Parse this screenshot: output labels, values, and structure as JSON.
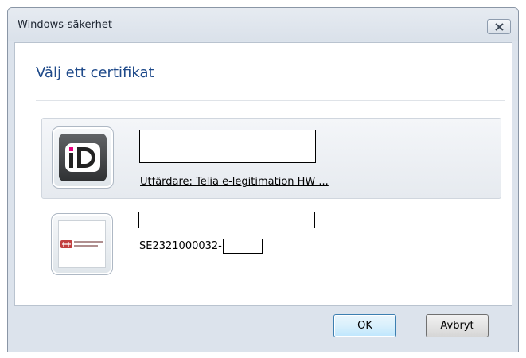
{
  "window": {
    "title": "Windows-säkerhet"
  },
  "dialog": {
    "heading": "Välj ett certifikat"
  },
  "certificates": [
    {
      "icon": "bankid-icon",
      "subject": "",
      "detail": "Utfärdare: Telia e-legitimation HW ...",
      "selected": true
    },
    {
      "icon": "county-seal-icon",
      "subject": "",
      "detail": "SE2321000032-",
      "selected": false
    }
  ],
  "buttons": {
    "ok": "OK",
    "cancel": "Avbryt"
  },
  "colors": {
    "heading": "#1f4a8a",
    "frame": "#dce3ec",
    "ok_border": "#3c7fb1"
  }
}
